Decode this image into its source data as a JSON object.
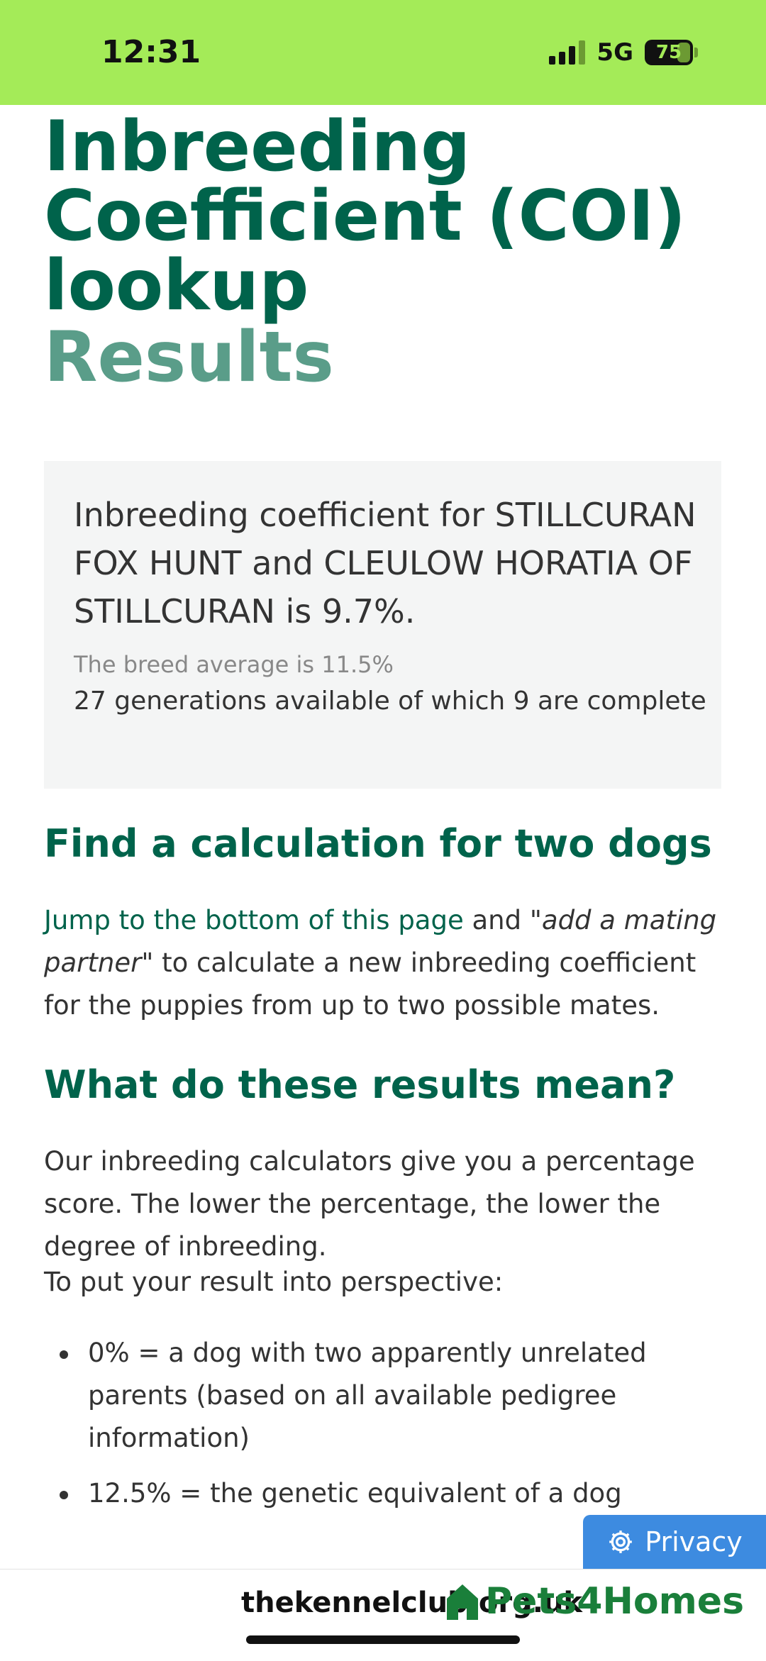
{
  "status": {
    "time": "12:31",
    "network": "5G",
    "battery": "75"
  },
  "page": {
    "title_line1": "Inbreeding",
    "title_line2": "Coefficient (COI)",
    "title_line3": "lookup",
    "subtitle": "Results"
  },
  "result": {
    "main": "Inbreeding coefficient for STILLCURAN FOX HUNT and CLEULOW HORATIA OF STILLCURAN is 9.7%.",
    "breed_average": "The breed average is 11.5%",
    "generations": "27 generations available of which 9 are complete"
  },
  "section1": {
    "heading": "Find a calculation for two dogs",
    "link": "Jump to the bottom of this page",
    "text_a": " and \"",
    "em": "add a mating partner",
    "text_b": "\" to calculate a new inbreeding coefficient for the puppies from up to two possible mates."
  },
  "section2": {
    "heading": "What do these results mean?",
    "para1": "Our inbreeding calculators give you a percentage score. The lower the percentage, the lower the degree of inbreeding.",
    "para2": "To put your result into perspective:",
    "bullets": [
      "0% = a dog with two apparently unrelated parents (based on all available pedigree information)",
      "12.5% = the genetic equivalent of a dog"
    ]
  },
  "privacy": {
    "label": "Privacy"
  },
  "browser": {
    "url": "thekennelclub.org.uk"
  },
  "watermark": {
    "label": "Pets4Homes"
  },
  "colors": {
    "status_bg": "#a4eb58",
    "heading": "#00634b",
    "subtitle": "#5a9d89",
    "privacy_bg": "#3d8be0"
  }
}
